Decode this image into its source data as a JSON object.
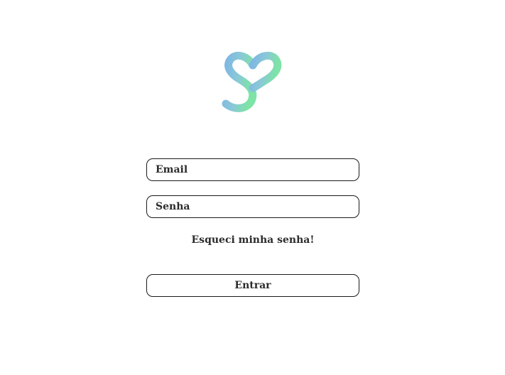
{
  "logo": {
    "icon": "heart-s-logo-icon",
    "colors": {
      "start": "#7fb6e3",
      "end": "#7ee3a6"
    }
  },
  "login": {
    "email_placeholder": "Email",
    "password_placeholder": "Senha",
    "forgot_password_label": "Esqueci minha senha!",
    "submit_label": "Entrar"
  }
}
